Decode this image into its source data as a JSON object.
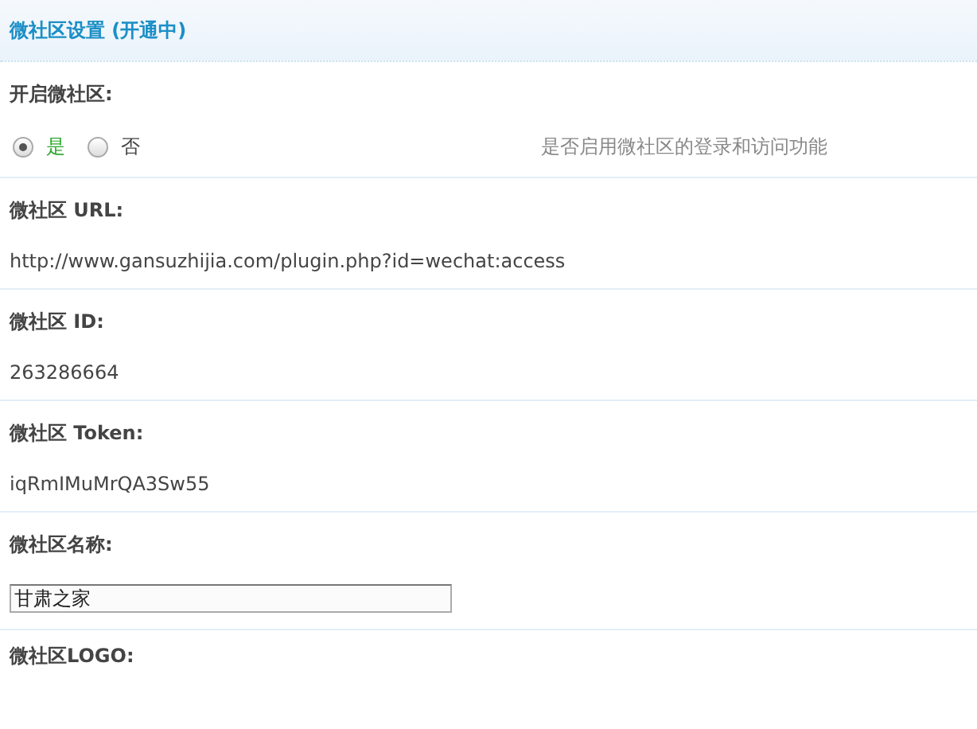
{
  "header": {
    "title": "微社区设置 (开通中)"
  },
  "settings": [
    {
      "kind": "radio",
      "label": "开启微社区:",
      "options": [
        {
          "label": "是",
          "selected": true
        },
        {
          "label": "否",
          "selected": false
        }
      ],
      "hint": "是否启用微社区的登录和访问功能"
    },
    {
      "kind": "text",
      "label": "微社区 URL:",
      "value": "http://www.gansuzhijia.com/plugin.php?id=wechat:access"
    },
    {
      "kind": "text",
      "label": "微社区 ID:",
      "value": "263286664"
    },
    {
      "kind": "text",
      "label": "微社区 Token:",
      "value": "iqRmIMuMrQA3Sw55"
    },
    {
      "kind": "input",
      "label": "微社区名称:",
      "value": "甘肃之家"
    },
    {
      "kind": "label",
      "label": "微社区LOGO:"
    }
  ]
}
